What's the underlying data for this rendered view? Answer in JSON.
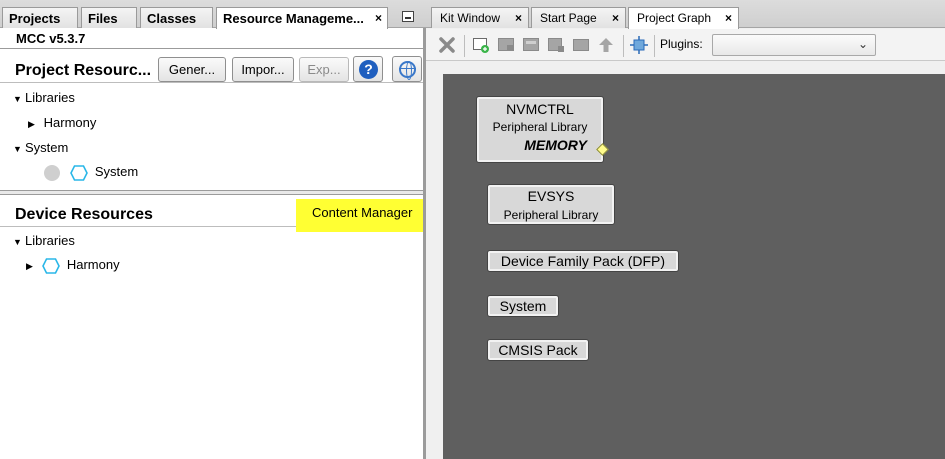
{
  "left_panel": {
    "tabs": [
      {
        "label": "Projects"
      },
      {
        "label": "Files"
      },
      {
        "label": "Classes"
      },
      {
        "label": "Resource Manageme...",
        "close": "×"
      }
    ],
    "mcc_version": "MCC v5.3.7",
    "project_resources": {
      "title": "Project Resourc...",
      "buttons": {
        "generate": "Gener...",
        "import": "Impor...",
        "export": "Exp...",
        "help": "?"
      },
      "tree": {
        "libraries": "Libraries",
        "harmony": "Harmony",
        "system_group": "System",
        "system_item": "System"
      }
    },
    "device_resources": {
      "title": "Device Resources",
      "content_manager": "Content Manager",
      "tree": {
        "libraries": "Libraries",
        "harmony": "Harmony"
      }
    }
  },
  "right_panel": {
    "tabs": [
      {
        "label": "Kit Window",
        "close": "×"
      },
      {
        "label": "Start Page",
        "close": "×"
      },
      {
        "label": "Project Graph",
        "close": "×"
      }
    ],
    "toolbar": {
      "icons": [
        "delete-icon",
        "add-node-icon",
        "node-icon",
        "node-icon",
        "node-icon",
        "node-icon",
        "arrow-up-icon",
        "fit-icon"
      ],
      "plugins_label": "Plugins:",
      "plugins_value": ""
    },
    "graph_nodes": {
      "nvmctrl": {
        "title": "NVMCTRL",
        "subtitle": "Peripheral Library",
        "tag": "MEMORY"
      },
      "evsys": {
        "title": "EVSYS",
        "subtitle": "Peripheral Library"
      },
      "dfp": {
        "title": "Device Family Pack (DFP)"
      },
      "system": {
        "title": "System"
      },
      "cmsis": {
        "title": "CMSIS Pack"
      }
    },
    "colors": {
      "canvas": "#5f5f5f",
      "highlight": "#ffff33",
      "hex_icon": "#2ab7e8"
    }
  }
}
